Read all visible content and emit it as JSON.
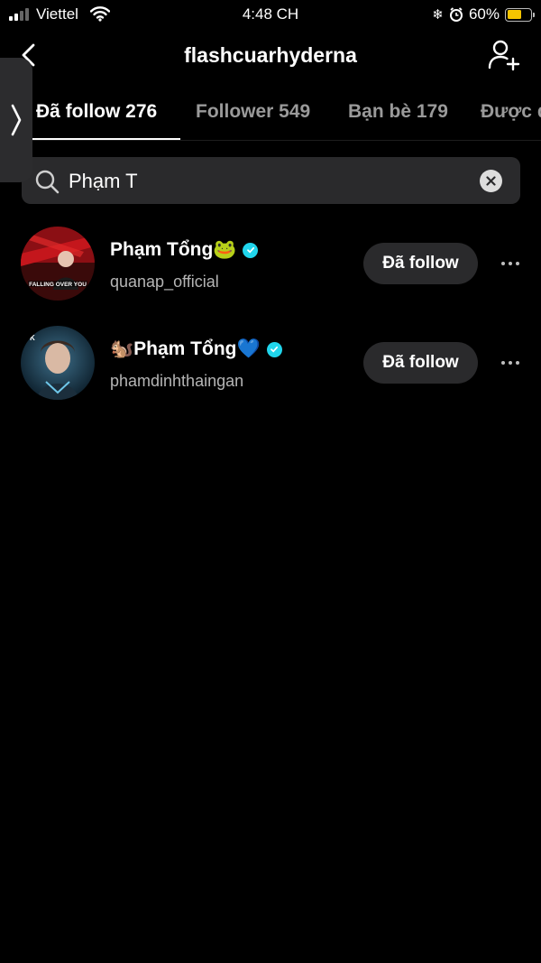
{
  "status_bar": {
    "carrier": "Viettel",
    "time": "4:48 CH",
    "battery_percent": "60%",
    "battery_level": 0.6,
    "icons": [
      "signal-icon",
      "wifi-icon",
      "snowflake-icon",
      "alarm-icon",
      "battery-icon"
    ]
  },
  "header": {
    "title": "flashcuarhyderna",
    "back_icon": "chevron-left-icon",
    "add_icon": "add-user-icon"
  },
  "tabs": [
    {
      "label": "Đã follow 276",
      "active": true
    },
    {
      "label": "Follower 549",
      "active": false
    },
    {
      "label": "Bạn bè 179",
      "active": false
    },
    {
      "label": "Được đ",
      "active": false
    }
  ],
  "search": {
    "value": "Phạm T",
    "icon": "search-icon",
    "clear_icon": "close-icon"
  },
  "results": [
    {
      "display_name": "Phạm Tổng🐸",
      "username": "quanap_official",
      "verified": true,
      "button_label": "Đã follow"
    },
    {
      "display_name": "🐿️Phạm Tổng💙",
      "username": "phamdinhthaingan",
      "verified": true,
      "button_label": "Đã follow"
    }
  ],
  "colors": {
    "background": "#000000",
    "surface": "#2a2a2c",
    "verified": "#20d5ec",
    "battery": "#f5c400"
  }
}
